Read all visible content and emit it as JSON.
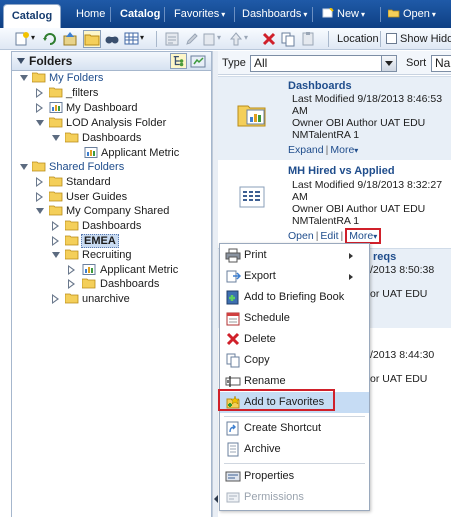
{
  "nav": {
    "catalog": "Catalog",
    "home": "Home",
    "catalog2": "Catalog",
    "favorites": "Favorites",
    "dashboards": "Dashboards",
    "new": "New",
    "open": "Open",
    "caret": "▾"
  },
  "toolbar": {
    "location": "Location",
    "show_hidden": "Show Hidd"
  },
  "folders": {
    "title": "Folders",
    "tree": [
      {
        "label": "My Folders"
      },
      {
        "label": "_filters"
      },
      {
        "label": "My Dashboard"
      },
      {
        "label": "LOD Analysis Folder"
      },
      {
        "label": "Dashboards"
      },
      {
        "label": "Applicant Metric"
      },
      {
        "label": "Shared Folders"
      },
      {
        "label": "Standard"
      },
      {
        "label": "User Guides"
      },
      {
        "label": "My Company Shared"
      },
      {
        "label": "Dashboards"
      },
      {
        "label": "EMEA"
      },
      {
        "label": "Recruiting"
      },
      {
        "label": "Applicant Metric"
      },
      {
        "label": "Dashboards"
      },
      {
        "label": "unarchive"
      }
    ]
  },
  "filter": {
    "type_label": "Type",
    "type_value": "All",
    "sort_label": "Sort",
    "sort_value": "Name"
  },
  "items": [
    {
      "title": "Dashboards",
      "meta1": "Last Modified 9/18/2013 8:46:53",
      "meta2": "AM",
      "meta3": "Owner OBI Author UAT EDU",
      "meta4": "NMTalentRA 1",
      "link1": "Expand",
      "link2": "More",
      "sep": "|"
    },
    {
      "title": "MH Hired vs Applied",
      "meta1": "Last Modified 9/18/2013 8:32:27",
      "meta2": "AM",
      "meta3": "Owner OBI Author UAT EDU",
      "meta4": "NMTalentRA 1",
      "link1": "Open",
      "link2": "Edit",
      "link3": "More",
      "sep": "|"
    }
  ],
  "partial": {
    "p1": "reqs",
    "p2": "/2013 8:50:38",
    "p3": "or UAT EDU",
    "p4": "/2013 8:44:30",
    "p5": "or UAT EDU"
  },
  "menu": {
    "items": [
      {
        "label": "Print"
      },
      {
        "label": "Export"
      },
      {
        "label": "Add to Briefing Book"
      },
      {
        "label": "Schedule"
      },
      {
        "label": "Delete"
      },
      {
        "label": "Copy"
      },
      {
        "label": "Rename"
      },
      {
        "label": "Add to Favorites"
      },
      {
        "label": "Create Shortcut"
      },
      {
        "label": "Archive"
      },
      {
        "label": "Properties"
      },
      {
        "label": "Permissions"
      }
    ]
  },
  "colors": {
    "nav_bg": "#1f5aa8",
    "link": "#1f4d8c",
    "highlight": "#d0202a",
    "menu_hover": "#c6dcf4"
  }
}
